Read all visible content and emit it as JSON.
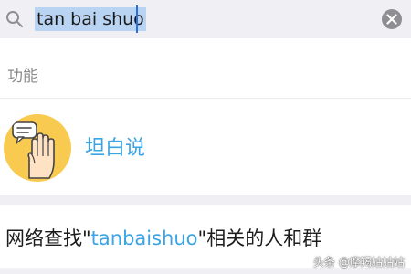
{
  "search": {
    "query": "tan bai shuo"
  },
  "sections": {
    "functions_label": "功能"
  },
  "result": {
    "app_name": "坦白说",
    "avatar_icon": "raised-hand-speech-bubble-icon",
    "avatar_color": "#f8ca50"
  },
  "network_search": {
    "prefix": "网络查找\"",
    "keyword": "tanbaishuo",
    "suffix": "\"相关的人和群"
  },
  "watermark": {
    "text": "头条 @摩羯姑姑姑"
  },
  "colors": {
    "accent": "#3aa4e4",
    "selection": "#b9d3f2",
    "bar_background": "#efeff4"
  }
}
